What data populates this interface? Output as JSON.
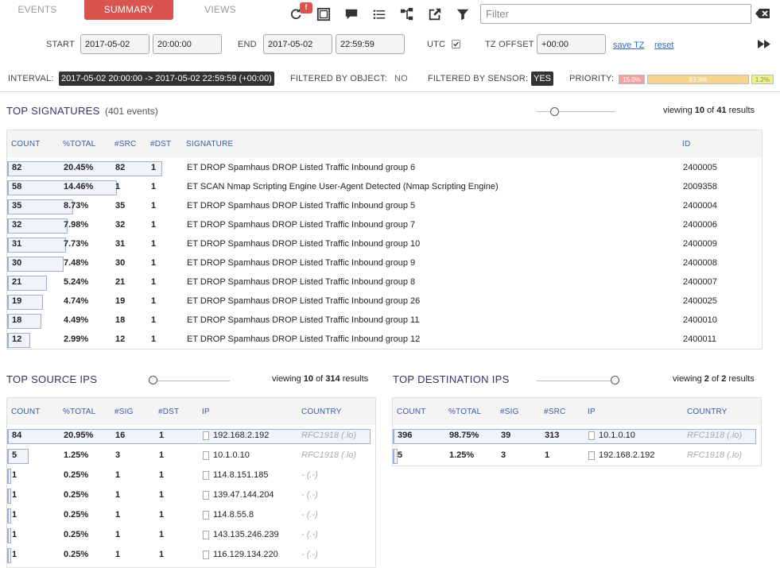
{
  "tabs": [
    {
      "label": "EVENTS",
      "active": false
    },
    {
      "label": "SUMMARY",
      "active": true
    },
    {
      "label": "VIEWS",
      "active": false
    }
  ],
  "toolbar": {
    "icons": [
      "refresh-icon",
      "fullscreen-icon",
      "comment-icon",
      "list-icon",
      "tree-icon",
      "external-link-icon",
      "filter-icon"
    ],
    "alert_badge": "!",
    "filter_placeholder": "Filter",
    "clear_icon": "backspace-icon"
  },
  "timebar": {
    "start_label": "START",
    "start_date": "2017-05-02",
    "start_time": "20:00:00",
    "end_label": "END",
    "end_date": "2017-05-02",
    "end_time": "22:59:59",
    "utc_label": "UTC",
    "utc_checked": true,
    "tz_label": "TZ OFFSET",
    "tz_value": "+00:00",
    "save_tz": "save TZ",
    "reset": "reset"
  },
  "status": {
    "interval_label": "INTERVAL:",
    "interval_value": "2017-05-02 20:00:00 -> 2017-05-02 22:59:59 (+00:00)",
    "filtered_object_label": "FILTERED BY OBJECT:",
    "filtered_object_value": "NO",
    "filtered_sensor_label": "FILTERED BY SENSOR:",
    "filtered_sensor_value": "YES",
    "priority_label": "PRIORITY:",
    "priority": [
      {
        "label": "15.0%",
        "value": 15.0,
        "color": "#f2a0a0"
      },
      {
        "label": "83.8%",
        "value": 83.8,
        "color": "#f5d58e"
      },
      {
        "label": "1.2%",
        "value": 1.2,
        "color": "#f0f08a"
      }
    ]
  },
  "signatures": {
    "title": "TOP SIGNATURES",
    "subtitle": "(401 events)",
    "viewing_prefix": "viewing",
    "viewing_count": "10",
    "viewing_of": "of",
    "viewing_total": "41",
    "viewing_suffix": "results",
    "headers": {
      "count": "COUNT",
      "total": "%TOTAL",
      "src": "#SRC",
      "dst": "#DST",
      "signature": "SIGNATURE",
      "id": "ID"
    },
    "rows": [
      {
        "count": "82",
        "total": "20.45%",
        "pct": 20.45,
        "src": "82",
        "dst": "1",
        "signature": "ET DROP Spamhaus DROP Listed Traffic Inbound group 6",
        "id": "2400005"
      },
      {
        "count": "58",
        "total": "14.46%",
        "pct": 14.46,
        "src": "1",
        "dst": "1",
        "signature": "ET SCAN Nmap Scripting Engine User-Agent Detected (Nmap Scripting Engine)",
        "id": "2009358"
      },
      {
        "count": "35",
        "total": "8.73%",
        "pct": 8.73,
        "src": "35",
        "dst": "1",
        "signature": "ET DROP Spamhaus DROP Listed Traffic Inbound group 5",
        "id": "2400004"
      },
      {
        "count": "32",
        "total": "7.98%",
        "pct": 7.98,
        "src": "32",
        "dst": "1",
        "signature": "ET DROP Spamhaus DROP Listed Traffic Inbound group 7",
        "id": "2400006"
      },
      {
        "count": "31",
        "total": "7.73%",
        "pct": 7.73,
        "src": "31",
        "dst": "1",
        "signature": "ET DROP Spamhaus DROP Listed Traffic Inbound group 10",
        "id": "2400009"
      },
      {
        "count": "30",
        "total": "7.48%",
        "pct": 7.48,
        "src": "30",
        "dst": "1",
        "signature": "ET DROP Spamhaus DROP Listed Traffic Inbound group 9",
        "id": "2400008"
      },
      {
        "count": "21",
        "total": "5.24%",
        "pct": 5.24,
        "src": "21",
        "dst": "1",
        "signature": "ET DROP Spamhaus DROP Listed Traffic Inbound group 8",
        "id": "2400007"
      },
      {
        "count": "19",
        "total": "4.74%",
        "pct": 4.74,
        "src": "19",
        "dst": "1",
        "signature": "ET DROP Spamhaus DROP Listed Traffic Inbound group 26",
        "id": "2400025"
      },
      {
        "count": "18",
        "total": "4.49%",
        "pct": 4.49,
        "src": "18",
        "dst": "1",
        "signature": "ET DROP Spamhaus DROP Listed Traffic Inbound group 11",
        "id": "2400010"
      },
      {
        "count": "12",
        "total": "2.99%",
        "pct": 2.99,
        "src": "12",
        "dst": "1",
        "signature": "ET DROP Spamhaus DROP Listed Traffic Inbound group 12",
        "id": "2400011"
      }
    ]
  },
  "source_ips": {
    "title": "TOP SOURCE IPS",
    "viewing_prefix": "viewing",
    "viewing_count": "10",
    "viewing_of": "of",
    "viewing_total": "314",
    "viewing_suffix": "results",
    "headers": {
      "count": "COUNT",
      "total": "%TOTAL",
      "sig": "#SIG",
      "dst": "#DST",
      "ip": "IP",
      "country": "COUNTRY"
    },
    "rows": [
      {
        "count": "84",
        "total": "20.95%",
        "pct": 20.95,
        "sig": "16",
        "dst": "1",
        "ip": "192.168.2.192",
        "country": "RFC1918 (.lo)"
      },
      {
        "count": "5",
        "total": "1.25%",
        "pct": 1.25,
        "sig": "3",
        "dst": "1",
        "ip": "10.1.0.10",
        "country": "RFC1918 (.lo)"
      },
      {
        "count": "1",
        "total": "0.25%",
        "pct": 0.25,
        "sig": "1",
        "dst": "1",
        "ip": "114.8.151.185",
        "country": "- (.-)"
      },
      {
        "count": "1",
        "total": "0.25%",
        "pct": 0.25,
        "sig": "1",
        "dst": "1",
        "ip": "139.47.144.204",
        "country": "- (.-)"
      },
      {
        "count": "1",
        "total": "0.25%",
        "pct": 0.25,
        "sig": "1",
        "dst": "1",
        "ip": "114.8.55.8",
        "country": "- (.-)"
      },
      {
        "count": "1",
        "total": "0.25%",
        "pct": 0.25,
        "sig": "1",
        "dst": "1",
        "ip": "143.135.246.239",
        "country": "- (.-)"
      },
      {
        "count": "1",
        "total": "0.25%",
        "pct": 0.25,
        "sig": "1",
        "dst": "1",
        "ip": "116.129.134.220",
        "country": "- (.-)"
      }
    ]
  },
  "dest_ips": {
    "title": "TOP DESTINATION IPS",
    "viewing_prefix": "viewing",
    "viewing_count": "2",
    "viewing_of": "of",
    "viewing_total": "2",
    "viewing_suffix": "results",
    "headers": {
      "count": "COUNT",
      "total": "%TOTAL",
      "sig": "#SIG",
      "src": "#SRC",
      "ip": "IP",
      "country": "COUNTRY"
    },
    "rows": [
      {
        "count": "396",
        "total": "98.75%",
        "pct": 98.75,
        "sig": "39",
        "src": "313",
        "ip": "10.1.0.10",
        "country": "RFC1918 (.lo)"
      },
      {
        "count": "5",
        "total": "1.25%",
        "pct": 1.25,
        "sig": "3",
        "src": "1",
        "ip": "192.168.2.192",
        "country": "RFC1918 (.lo)"
      }
    ]
  }
}
